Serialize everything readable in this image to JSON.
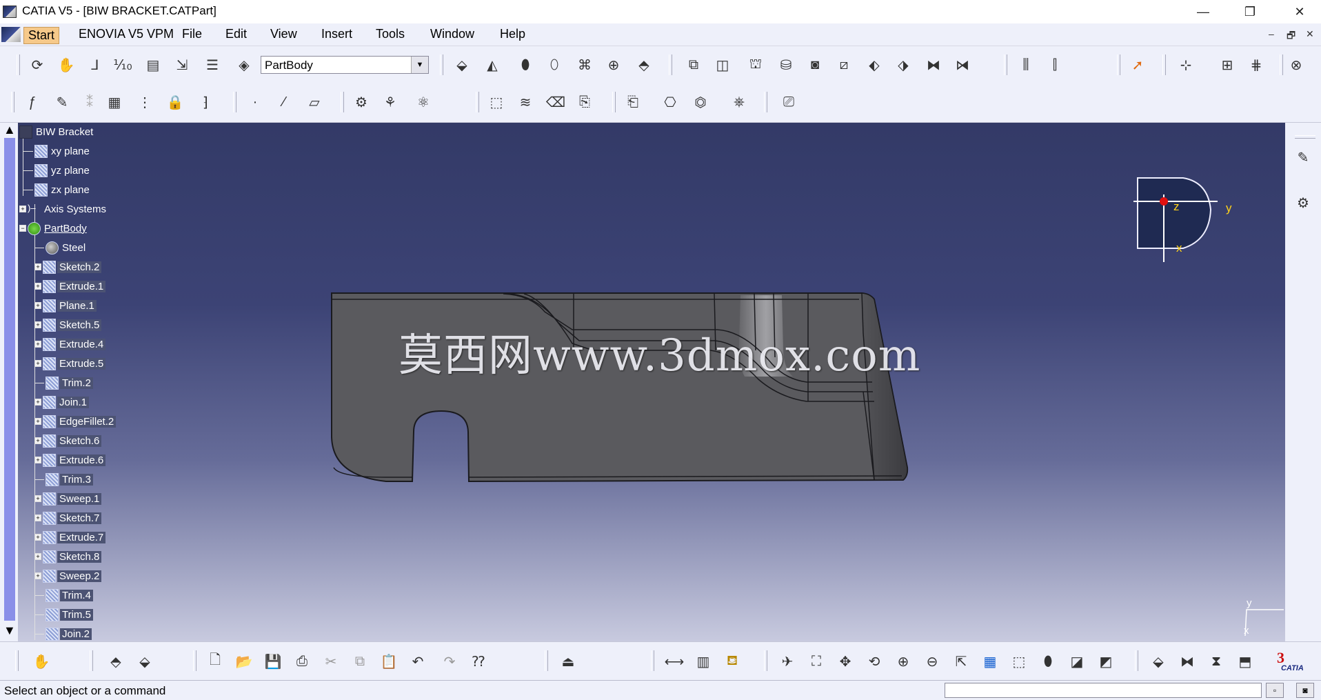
{
  "window": {
    "title": "CATIA V5 - [BIW BRACKET.CATPart]",
    "minimize_glyph": "—",
    "maximize_glyph": "❐",
    "close_glyph": "✕"
  },
  "menubar": {
    "items": [
      "Start",
      "ENOVIA V5 VPM",
      "File",
      "Edit",
      "View",
      "Insert",
      "Tools",
      "Window",
      "Help"
    ],
    "mdi_minimize": "–",
    "mdi_restore": "🗗",
    "mdi_close": "✕"
  },
  "toolbar": {
    "body_selector": {
      "value": "PartBody",
      "arrow": "▼"
    }
  },
  "tree": {
    "root": "BIW Bracket",
    "nodes": [
      {
        "label": "xy plane"
      },
      {
        "label": "yz plane"
      },
      {
        "label": "zx plane"
      },
      {
        "label": "Axis Systems"
      },
      {
        "label": "PartBody"
      },
      {
        "label": "Steel"
      },
      {
        "label": "Sketch.2"
      },
      {
        "label": "Extrude.1"
      },
      {
        "label": "Plane.1"
      },
      {
        "label": "Sketch.5"
      },
      {
        "label": "Extrude.4"
      },
      {
        "label": "Extrude.5"
      },
      {
        "label": "Trim.2"
      },
      {
        "label": "Join.1"
      },
      {
        "label": "EdgeFillet.2"
      },
      {
        "label": "Sketch.6"
      },
      {
        "label": "Extrude.6"
      },
      {
        "label": "Trim.3"
      },
      {
        "label": "Sweep.1"
      },
      {
        "label": "Sketch.7"
      },
      {
        "label": "Extrude.7"
      },
      {
        "label": "Sketch.8"
      },
      {
        "label": "Sweep.2"
      },
      {
        "label": "Trim.4"
      },
      {
        "label": "Trim.5"
      },
      {
        "label": "Join.2"
      }
    ],
    "scroll_up": "▲",
    "scroll_down": "▼"
  },
  "watermark": "莫西网www.3dmox.com",
  "compass": {
    "z": "z",
    "y": "y",
    "x": "x"
  },
  "axis_triad": {
    "y": "y",
    "x": "x"
  },
  "status": {
    "message": "Select an object or a command",
    "btn1": "▫",
    "btn2": "◙"
  },
  "catia_logo": "CATIA",
  "colors": {
    "background_top": "#333a67",
    "background_bottom": "#c8cadf",
    "part_fill": "#5a5a5e",
    "compass_fill": "#1f2a52",
    "compass_origin": "#e01010",
    "selection": "#4c5373",
    "accent_text": "#ffd21a",
    "scroll_thumb": "#8a8fe8"
  }
}
